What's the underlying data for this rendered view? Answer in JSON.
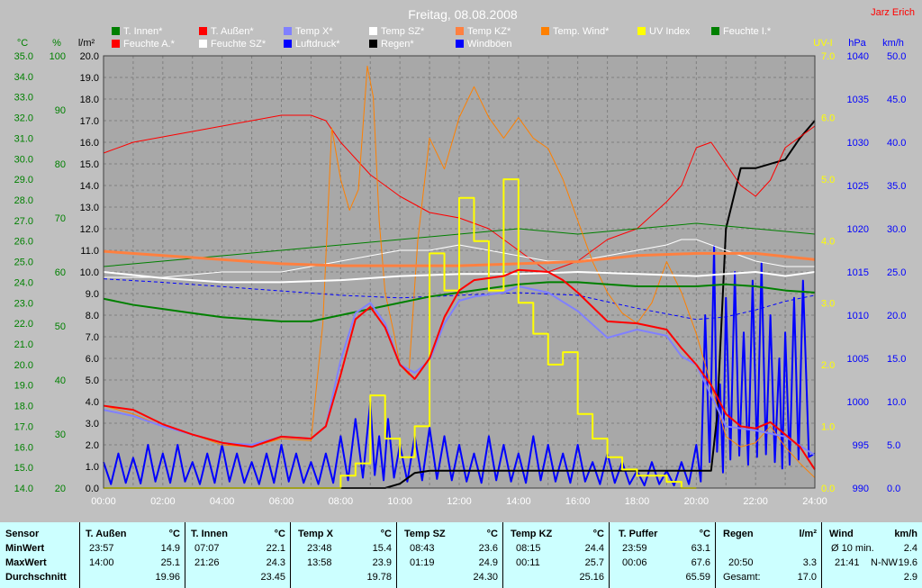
{
  "chart_data": {
    "type": "line",
    "title": "Freitag, 08.08.2008",
    "author": "Jarz Erich",
    "x_tick_labels": [
      "00:00",
      "02:00",
      "04:00",
      "06:00",
      "08:00",
      "10:00",
      "12:00",
      "14:00",
      "16:00",
      "18:00",
      "20:00",
      "22:00",
      "24:00"
    ],
    "xlim": [
      0,
      24
    ],
    "axes": {
      "temp": {
        "label": "°C",
        "ylim": [
          14.0,
          35.0
        ],
        "ticks": [
          "14.0",
          "15.0",
          "16.0",
          "17.0",
          "18.0",
          "19.0",
          "20.0",
          "21.0",
          "22.0",
          "23.0",
          "24.0",
          "25.0",
          "26.0",
          "27.0",
          "28.0",
          "29.0",
          "30.0",
          "31.0",
          "32.0",
          "33.0",
          "34.0",
          "35.0"
        ],
        "color": "#008000"
      },
      "humidity": {
        "label": "%",
        "ylim": [
          20,
          100
        ],
        "ticks": [
          "20",
          "30",
          "40",
          "50",
          "60",
          "70",
          "80",
          "90",
          "100"
        ],
        "color": "#008000"
      },
      "rain": {
        "label": "l/m²",
        "ylim": [
          0.0,
          20.0
        ],
        "ticks": [
          "0.0",
          "1.0",
          "2.0",
          "3.0",
          "4.0",
          "5.0",
          "6.0",
          "7.0",
          "8.0",
          "9.0",
          "10.0",
          "11.0",
          "12.0",
          "13.0",
          "14.0",
          "15.0",
          "16.0",
          "17.0",
          "18.0",
          "19.0",
          "20.0"
        ],
        "color": "#000000"
      },
      "uv": {
        "label": "UV-I",
        "ylim": [
          0.0,
          7.0
        ],
        "ticks": [
          "0.0",
          "1.0",
          "2.0",
          "3.0",
          "4.0",
          "5.0",
          "6.0",
          "7.0"
        ],
        "color": "#ffff00"
      },
      "pressure": {
        "label": "hPa",
        "ylim": [
          990,
          1040
        ],
        "ticks": [
          "990",
          "995",
          "1000",
          "1005",
          "1010",
          "1015",
          "1020",
          "1025",
          "1030",
          "1035",
          "1040"
        ],
        "color": "#0000ff"
      },
      "wind": {
        "label": "km/h",
        "ylim": [
          0.0,
          50.0
        ],
        "ticks": [
          "0.0",
          "5.0",
          "10.0",
          "15.0",
          "20.0",
          "25.0",
          "30.0",
          "35.0",
          "40.0",
          "45.0",
          "50.0"
        ],
        "color": "#0000ff"
      }
    },
    "legend": [
      {
        "name": "T. Innen*",
        "color": "#008000"
      },
      {
        "name": "T. Außen*",
        "color": "#ff0000"
      },
      {
        "name": "Temp X*",
        "color": "#8080ff"
      },
      {
        "name": "Temp SZ*",
        "color": "#ffffff"
      },
      {
        "name": "Temp KZ*",
        "color": "#ff8040"
      },
      {
        "name": "Temp. Wind*",
        "color": "#ff8000"
      },
      {
        "name": "UV Index",
        "color": "#ffff00"
      },
      {
        "name": "Feuchte I.*",
        "color": "#008000"
      },
      {
        "name": "Feuchte A.*",
        "color": "#ff0000"
      },
      {
        "name": "Feuchte SZ*",
        "color": "#ffffff"
      },
      {
        "name": "Luftdruck*",
        "color": "#0000ff"
      },
      {
        "name": "Regen*",
        "color": "#000000"
      },
      {
        "name": "Windböen",
        "color": "#0000ff"
      }
    ],
    "series": [
      {
        "name": "T. Außen*",
        "axis": "temp",
        "color": "#ff0000",
        "width": 2,
        "x": [
          0,
          1,
          2,
          3,
          4,
          5,
          6,
          7,
          7.5,
          8,
          8.5,
          9,
          9.5,
          10,
          10.5,
          11,
          11.5,
          12,
          12.5,
          13,
          13.5,
          14,
          15,
          15.5,
          16,
          17,
          18,
          19,
          19.5,
          20,
          20.5,
          21,
          21.5,
          22,
          22.5,
          23,
          23.5,
          24
        ],
        "y": [
          18.0,
          17.8,
          17.1,
          16.6,
          16.2,
          16.0,
          16.5,
          16.4,
          17.0,
          19.5,
          22.2,
          22.8,
          21.8,
          20.0,
          19.3,
          20.3,
          22.3,
          23.6,
          24.1,
          24.2,
          24.3,
          24.6,
          24.5,
          24.1,
          23.5,
          22.1,
          22.0,
          21.7,
          20.8,
          20.0,
          19.0,
          17.6,
          17.0,
          16.9,
          17.2,
          16.6,
          16.0,
          14.9
        ]
      },
      {
        "name": "T. Innen*",
        "axis": "temp",
        "color": "#008000",
        "width": 2,
        "x": [
          0,
          1,
          2,
          3,
          4,
          5,
          6,
          7,
          8,
          9,
          10,
          11,
          12,
          13,
          14,
          15,
          16,
          17,
          18,
          19,
          20,
          21,
          22,
          23,
          24
        ],
        "y": [
          23.2,
          22.9,
          22.7,
          22.5,
          22.3,
          22.2,
          22.1,
          22.1,
          22.4,
          22.7,
          23.0,
          23.3,
          23.5,
          23.7,
          23.9,
          24.0,
          24.0,
          23.9,
          23.8,
          23.8,
          23.8,
          23.9,
          23.8,
          23.6,
          23.5
        ]
      },
      {
        "name": "Temp X*",
        "axis": "temp",
        "color": "#8080ff",
        "width": 2,
        "x": [
          0,
          1,
          2,
          3,
          4,
          5,
          6,
          7,
          7.5,
          8,
          8.5,
          9,
          9.5,
          10,
          10.5,
          11,
          11.5,
          12,
          12.5,
          13,
          13.5,
          14,
          15,
          16,
          17,
          18,
          19,
          19.5,
          20,
          20.5,
          21,
          22,
          23,
          24
        ],
        "y": [
          17.8,
          17.5,
          17.0,
          16.6,
          16.2,
          16.1,
          16.5,
          16.4,
          17.0,
          20.2,
          22.5,
          23.0,
          22.0,
          20.0,
          19.6,
          20.2,
          22.0,
          23.1,
          23.3,
          23.4,
          23.5,
          23.8,
          23.5,
          22.6,
          21.3,
          21.7,
          21.4,
          20.4,
          20.0,
          18.5,
          17.0,
          16.8,
          16.5,
          15.6
        ]
      },
      {
        "name": "Temp SZ*",
        "axis": "temp",
        "color": "#ffffff",
        "width": 2,
        "x": [
          0,
          2,
          4,
          6,
          8,
          10,
          12,
          14,
          16,
          18,
          20,
          21,
          22,
          23,
          24
        ],
        "y": [
          24.5,
          24.2,
          24.0,
          24.0,
          24.1,
          24.3,
          24.4,
          24.4,
          24.5,
          24.4,
          24.3,
          24.4,
          24.5,
          24.3,
          24.5
        ]
      },
      {
        "name": "Temp KZ*",
        "axis": "temp",
        "color": "#ff8040",
        "width": 3,
        "x": [
          0,
          2,
          4,
          6,
          8,
          10,
          12,
          14,
          16,
          18,
          20,
          22,
          24
        ],
        "y": [
          25.5,
          25.3,
          25.1,
          24.9,
          24.8,
          24.8,
          24.8,
          24.9,
          25.0,
          25.3,
          25.4,
          25.4,
          25.1
        ]
      },
      {
        "name": "Temp. Wind*",
        "axis": "temp",
        "color": "#ff8000",
        "width": 1,
        "x": [
          0,
          1,
          2,
          3,
          4,
          5,
          6,
          7,
          7.4,
          7.7,
          8,
          8.3,
          8.6,
          8.9,
          9.1,
          9.3,
          9.5,
          9.8,
          10,
          10.3,
          10.6,
          11,
          11.5,
          12,
          12.5,
          13,
          13.5,
          14,
          14.5,
          15,
          15.5,
          16,
          16.5,
          17,
          17.5,
          18,
          18.5,
          19,
          19.5,
          20,
          20.5,
          21,
          21.5,
          22,
          22.5,
          23,
          23.5,
          24
        ],
        "y": [
          18.0,
          17.6,
          17.0,
          16.6,
          16.1,
          16.0,
          16.4,
          16.3,
          22.0,
          31.5,
          29.0,
          27.5,
          28.5,
          34.5,
          33.0,
          27.0,
          23.5,
          21.5,
          20.0,
          19.5,
          26.0,
          31.0,
          29.5,
          32.0,
          33.5,
          32.0,
          31.0,
          32.0,
          31.0,
          30.5,
          29.0,
          27.0,
          25.0,
          23.5,
          22.5,
          22.0,
          23.0,
          25.0,
          23.5,
          21.5,
          19.0,
          16.5,
          16.0,
          16.2,
          17.0,
          16.0,
          15.2,
          14.5
        ]
      },
      {
        "name": "Feuchte I.*",
        "axis": "humidity",
        "color": "#008000",
        "width": 1,
        "x": [
          0,
          2,
          4,
          6,
          8,
          10,
          12,
          14,
          16,
          18,
          20,
          22,
          24
        ],
        "y": [
          61,
          62,
          63,
          64,
          65,
          66,
          67,
          68,
          67,
          68,
          69,
          68,
          67
        ]
      },
      {
        "name": "Feuchte A.*",
        "axis": "humidity",
        "color": "#ff0000",
        "width": 1,
        "x": [
          0,
          1,
          2,
          3,
          4,
          5,
          6,
          7,
          7.5,
          8,
          9,
          10,
          11,
          12,
          13,
          14,
          15,
          16,
          17,
          18,
          19,
          19.5,
          20,
          20.5,
          21,
          21.5,
          22,
          22.5,
          23,
          23.5,
          24
        ],
        "y": [
          82,
          84,
          85,
          86,
          87,
          88,
          89,
          89,
          88,
          84,
          78,
          74,
          71,
          70,
          68,
          64,
          60,
          62,
          66,
          68,
          73,
          76,
          83,
          84,
          80,
          76,
          74,
          77,
          83,
          85,
          87
        ]
      },
      {
        "name": "Feuchte SZ*",
        "axis": "humidity",
        "color": "#ffffff",
        "width": 1,
        "x": [
          0,
          2,
          4,
          6,
          8,
          9,
          10,
          11,
          12,
          13,
          14,
          15,
          16,
          17,
          18,
          19,
          19.5,
          20,
          21,
          22,
          23,
          24
        ],
        "y": [
          59,
          59,
          60,
          60,
          62,
          63,
          64,
          64,
          65,
          64,
          63,
          62,
          62,
          63,
          64,
          65,
          66,
          66,
          64,
          62,
          61,
          61
        ]
      },
      {
        "name": "Luftdruck*",
        "axis": "pressure",
        "color": "#0000ff",
        "width": 1,
        "dashed": true,
        "x": [
          0,
          2,
          4,
          6,
          8,
          10,
          12,
          14,
          16,
          18,
          20,
          21,
          22,
          23,
          24
        ],
        "y": [
          1014.2,
          1013.8,
          1013.3,
          1012.8,
          1012.3,
          1012.0,
          1012.3,
          1012.6,
          1012.3,
          1010.8,
          1009.5,
          1009.8,
          1010.6,
          1011.6,
          1012.3
        ]
      },
      {
        "name": "Regen*",
        "axis": "rain",
        "color": "#000000",
        "width": 2,
        "x": [
          0,
          9.5,
          10,
          10.5,
          11,
          20.5,
          20.7,
          21,
          21.5,
          22,
          23,
          23.5,
          24
        ],
        "y": [
          0,
          0,
          0.2,
          0.7,
          0.8,
          0.8,
          3.3,
          12.0,
          14.8,
          14.8,
          15.2,
          16.2,
          17.0
        ]
      },
      {
        "name": "UV Index",
        "axis": "uv",
        "color": "#ffff00",
        "width": 2,
        "step": true,
        "x": [
          0,
          7.5,
          8,
          8.5,
          9,
          9.5,
          10,
          10.5,
          11,
          11.5,
          12,
          12.5,
          13,
          13.5,
          14,
          14.5,
          15,
          15.5,
          16,
          16.5,
          17,
          17.5,
          18,
          18.5,
          19,
          19.5,
          20
        ],
        "y": [
          0,
          0,
          0.2,
          0.4,
          1.5,
          0.8,
          0.5,
          1.0,
          3.8,
          3.2,
          4.7,
          4.0,
          3.2,
          5.0,
          3.0,
          2.5,
          2.0,
          2.2,
          1.2,
          0.8,
          0.5,
          0.3,
          0.2,
          0.2,
          0.1,
          0.0,
          0.0
        ]
      },
      {
        "name": "Windböen",
        "axis": "wind",
        "color": "#0000ff",
        "width": 2,
        "spiky": true,
        "x": [
          0,
          0.5,
          1,
          1.5,
          2,
          2.5,
          3,
          3.5,
          4,
          4.5,
          5,
          5.5,
          6,
          6.5,
          7,
          7.5,
          8,
          8.5,
          9,
          9.3,
          9.6,
          10,
          10.5,
          11,
          11.5,
          12,
          12.5,
          13,
          13.5,
          14,
          14.5,
          15,
          15.5,
          16,
          16.5,
          17,
          17.5,
          18,
          18.5,
          19,
          19.5,
          20,
          20.3,
          20.6,
          20.8,
          21,
          21.3,
          21.6,
          21.9,
          22.2,
          22.5,
          22.8,
          23,
          23.3,
          23.6,
          24
        ],
        "y": [
          3,
          4,
          3.5,
          5,
          4,
          5,
          3,
          4,
          5,
          4,
          3,
          4,
          5,
          4,
          3,
          4,
          6,
          8,
          10,
          6,
          8,
          5,
          6,
          7,
          6,
          5,
          4,
          6,
          5,
          4,
          6,
          5,
          4,
          5,
          3,
          4,
          3,
          2,
          3,
          2,
          3,
          5,
          20,
          28,
          12,
          22,
          25,
          18,
          24,
          26,
          20,
          15,
          18,
          22,
          24,
          4
        ]
      }
    ]
  },
  "stats": {
    "row_labels": [
      "Sensor",
      "MinWert",
      "MaxWert",
      "Durchschnitt"
    ],
    "columns": [
      {
        "header": "T. Außen",
        "unit": "°C",
        "min_time": "23:57",
        "min_val": "14.9",
        "max_time": "14:00",
        "max_val": "25.1",
        "avg": "19.96"
      },
      {
        "header": "T. Innen",
        "unit": "°C",
        "min_time": "07:07",
        "min_val": "22.1",
        "max_time": "21:26",
        "max_val": "24.3",
        "avg": "23.45"
      },
      {
        "header": "Temp X",
        "unit": "°C",
        "min_time": "23:48",
        "min_val": "15.4",
        "max_time": "13:58",
        "max_val": "23.9",
        "avg": "19.78"
      },
      {
        "header": "Temp SZ",
        "unit": "°C",
        "min_time": "08:43",
        "min_val": "23.6",
        "max_time": "01:19",
        "max_val": "24.9",
        "avg": "24.30"
      },
      {
        "header": "Temp KZ",
        "unit": "°C",
        "min_time": "08:15",
        "min_val": "24.4",
        "max_time": "00:11",
        "max_val": "25.7",
        "avg": "25.16"
      },
      {
        "header": "T. Puffer",
        "unit": "°C",
        "min_time": "23:59",
        "min_val": "63.1",
        "max_time": "00:06",
        "max_val": "67.6",
        "avg": "65.59"
      }
    ],
    "regen": {
      "header": "Regen",
      "unit": "l/m²",
      "min_time": "20:50",
      "min_val": "3.3",
      "total_label": "Gesamt:",
      "total_val": "17.0"
    },
    "wind": {
      "header": "Wind",
      "unit": "km/h",
      "avg_label": "Ø 10 min.",
      "avg_val": "2.4",
      "max_time": "21:41",
      "max_dir": "N-NW",
      "max_val": "19.6",
      "mean_val": "2.9"
    }
  }
}
